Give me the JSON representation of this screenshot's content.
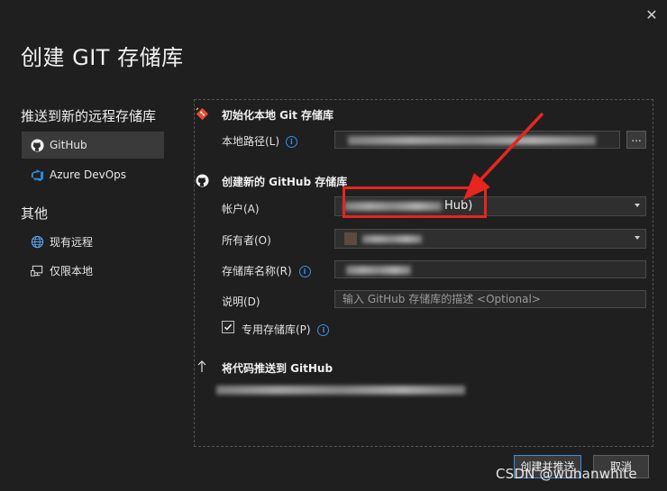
{
  "dialog": {
    "title": "创建 GIT 存储库",
    "close_glyph": "✕"
  },
  "sidebar": {
    "push_heading": "推送到新的远程存储库",
    "push_items": [
      {
        "label": "GitHub",
        "icon": "github-icon",
        "selected": true
      },
      {
        "label": "Azure DevOps",
        "icon": "azure-devops-icon",
        "selected": false
      }
    ],
    "other_heading": "其他",
    "other_items": [
      {
        "label": "现有远程",
        "icon": "globe-icon"
      },
      {
        "label": "仅限本地",
        "icon": "local-computer-icon"
      }
    ]
  },
  "init_section": {
    "title": "初始化本地 Git 存储库",
    "icon": "git-icon",
    "local_path_label": "本地路径(L)",
    "browse_label": "..."
  },
  "github_section": {
    "title": "创建新的 GitHub 存储库",
    "icon": "github-icon",
    "account_label": "帐户(A)",
    "account_visible_suffix": "Hub)",
    "owner_label": "所有者(O)",
    "repo_name_label": "存储库名称(R)",
    "description_label": "说明(D)",
    "description_placeholder": "输入 GitHub 存储库的描述 <Optional>",
    "private_label": "专用存储库(P)",
    "private_checked": true,
    "info_glyph": "i"
  },
  "push_section": {
    "title": "将代码推送到 GitHub",
    "icon": "upload-arrow-icon"
  },
  "buttons": {
    "create_push": "创建并推送",
    "cancel": "取消"
  },
  "watermark": "CSDN @wuhanwhite",
  "colors": {
    "background": "#1f1f1f",
    "accent": "#3c8ee8",
    "annotation": "#e8251f"
  }
}
